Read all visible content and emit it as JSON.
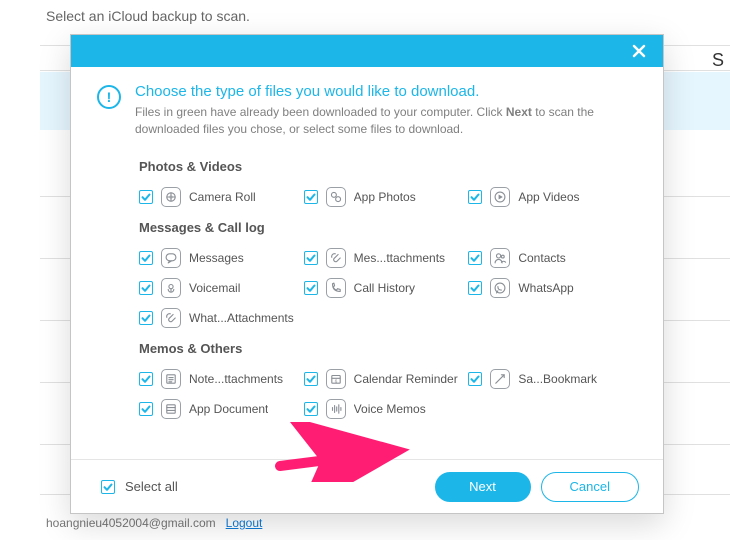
{
  "page": {
    "title": "Select an iCloud backup to scan.",
    "truncated_right": "S",
    "footer_email": "hoangnieu4052004@gmail.com",
    "logout": "Logout"
  },
  "modal": {
    "intro_title": "Choose the type of files you would like to download.",
    "intro_sub_before": "Files in green have already been downloaded to your computer. Click ",
    "intro_sub_bold": "Next",
    "intro_sub_after": " to scan the downloaded files you chose, or select some files to download.",
    "groups": [
      {
        "title": "Photos & Videos",
        "rows": [
          [
            {
              "label": "Camera Roll",
              "icon": "camera-roll",
              "checked": true,
              "name": "item-camera-roll"
            },
            {
              "label": "App Photos",
              "icon": "app-photos",
              "checked": true,
              "name": "item-app-photos"
            },
            {
              "label": "App Videos",
              "icon": "app-videos",
              "checked": true,
              "name": "item-app-videos"
            }
          ]
        ]
      },
      {
        "title": "Messages & Call log",
        "rows": [
          [
            {
              "label": "Messages",
              "icon": "messages",
              "checked": true,
              "name": "item-messages"
            },
            {
              "label": "Mes...ttachments",
              "icon": "attachments",
              "checked": true,
              "name": "item-message-attachments"
            },
            {
              "label": "Contacts",
              "icon": "contacts",
              "checked": true,
              "name": "item-contacts"
            }
          ],
          [
            {
              "label": "Voicemail",
              "icon": "voicemail",
              "checked": true,
              "name": "item-voicemail"
            },
            {
              "label": "Call History",
              "icon": "call-history",
              "checked": true,
              "name": "item-call-history"
            },
            {
              "label": "WhatsApp",
              "icon": "whatsapp",
              "checked": true,
              "name": "item-whatsapp"
            }
          ],
          [
            {
              "label": "What...Attachments",
              "icon": "attachments",
              "checked": true,
              "name": "item-whatsapp-attachments"
            },
            null,
            null
          ]
        ]
      },
      {
        "title": "Memos & Others",
        "rows": [
          [
            {
              "label": "Note...ttachments",
              "icon": "notes",
              "checked": true,
              "name": "item-note-attachments"
            },
            {
              "label": "Calendar Reminder",
              "icon": "calendar",
              "checked": true,
              "name": "item-calendar-reminder"
            },
            {
              "label": "Sa...Bookmark",
              "icon": "bookmark",
              "checked": true,
              "name": "item-safari-bookmark"
            }
          ],
          [
            {
              "label": "App Document",
              "icon": "document",
              "checked": true,
              "name": "item-app-document"
            },
            {
              "label": "Voice Memos",
              "icon": "voice-memos",
              "checked": true,
              "name": "item-voice-memos"
            },
            null
          ]
        ]
      }
    ],
    "select_all": {
      "checked": true,
      "label": "Select all"
    },
    "buttons": {
      "next": "Next",
      "cancel": "Cancel"
    }
  },
  "colors": {
    "accent": "#1cb6e8",
    "arrow": "#ff1d74"
  }
}
